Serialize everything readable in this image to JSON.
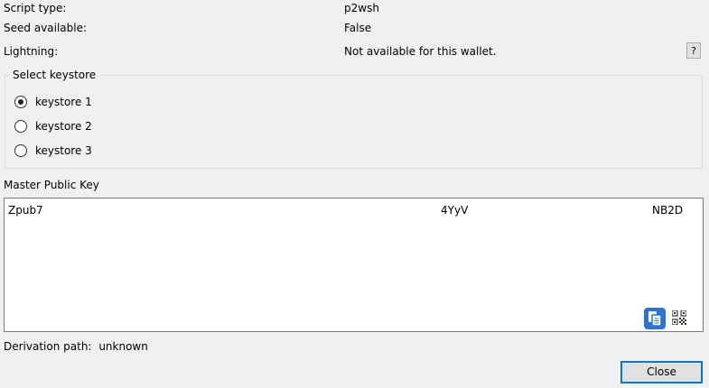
{
  "info": {
    "script_type_label": "Script type:",
    "script_type_value": "p2wsh",
    "seed_label": "Seed available:",
    "seed_value": "False",
    "lightning_label": "Lightning:",
    "lightning_value": "Not available for this wallet.",
    "help_label": "?"
  },
  "keystore": {
    "title": "Select keystore",
    "options": [
      {
        "label": "keystore 1",
        "selected": true
      },
      {
        "label": "keystore 2",
        "selected": false
      },
      {
        "label": "keystore 3",
        "selected": false
      }
    ]
  },
  "mpk": {
    "label": "Master Public Key",
    "fragments": [
      "Zpub7",
      "4YyV",
      "NB2D"
    ]
  },
  "derivation": {
    "label": "Derivation path:",
    "value": "unknown"
  },
  "buttons": {
    "close_label": "Close"
  },
  "icons": {
    "copy": "copy-icon",
    "qr": "qr-code-icon"
  },
  "colors": {
    "copy_button": "#2b73d6",
    "close_border": "#0078d7"
  }
}
